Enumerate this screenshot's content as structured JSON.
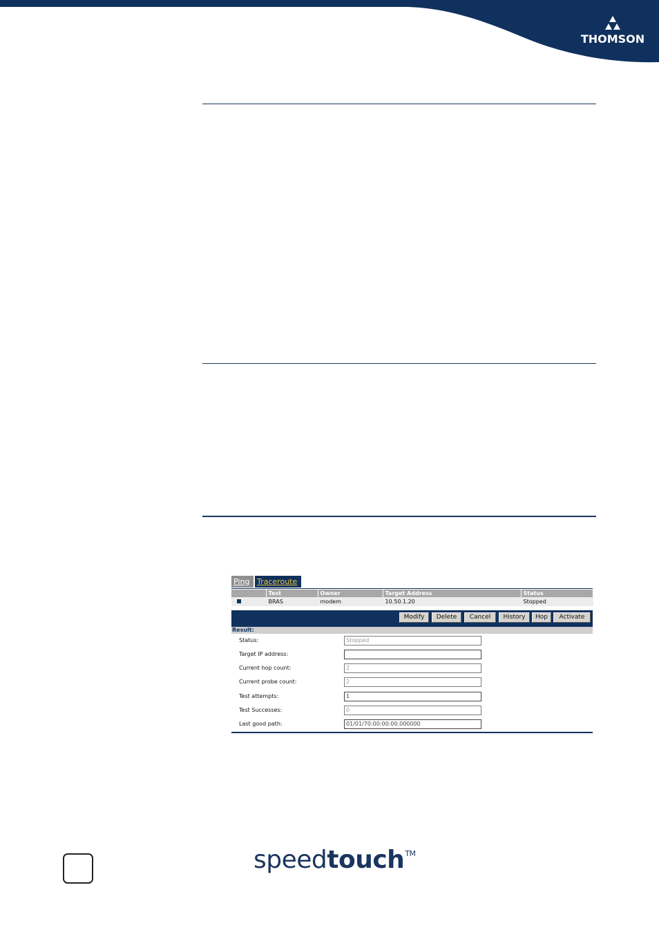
{
  "header": {
    "logo_text": "THOMSON",
    "band_color": "#10315e"
  },
  "panel": {
    "tabs": [
      {
        "label": "Ping",
        "active": false
      },
      {
        "label": "Traceroute",
        "active": true
      }
    ],
    "table": {
      "columns": [
        "",
        "Test",
        "Owner",
        "Target Address",
        "Status"
      ],
      "rows": [
        {
          "test": "BRAS",
          "owner": "modem",
          "target": "10.50.1.20",
          "status": "Stopped"
        }
      ]
    },
    "buttons": [
      "Modify",
      "Delete",
      "Cancel",
      "History",
      "Hop",
      "Activate"
    ],
    "result": {
      "title": "Result:",
      "fields": [
        {
          "label": "Status:",
          "value": "Stopped"
        },
        {
          "label": "Target IP address:",
          "value": ""
        },
        {
          "label": "Current hop count:",
          "value": "2"
        },
        {
          "label": "Current probe count:",
          "value": "2"
        },
        {
          "label": "Test attempts:",
          "value": "1"
        },
        {
          "label": "Test Successes:",
          "value": "0"
        },
        {
          "label": "Last good path:",
          "value": "01/01/70:00:00:00.000000"
        }
      ]
    }
  },
  "footer": {
    "brand_part1": "speed",
    "brand_part2": "touch",
    "brand_tm": "TM"
  },
  "colors": {
    "navy": "#10315e",
    "tab_gold": "#e8c441",
    "grey_header": "#a8a8a8"
  }
}
